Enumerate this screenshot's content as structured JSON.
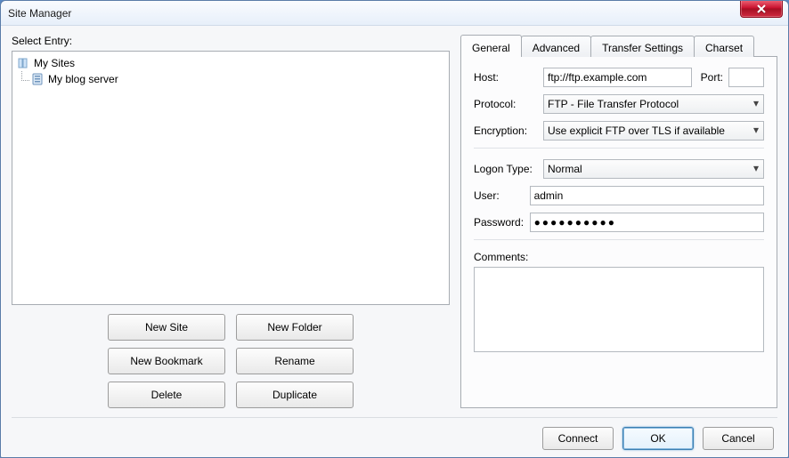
{
  "window": {
    "title": "Site Manager"
  },
  "left": {
    "select_label": "Select Entry:",
    "tree_root": "My Sites",
    "tree_child": "My blog server",
    "buttons": {
      "new_site": "New Site",
      "new_folder": "New Folder",
      "new_bookmark": "New Bookmark",
      "rename": "Rename",
      "delete": "Delete",
      "duplicate": "Duplicate"
    }
  },
  "tabs": {
    "general": "General",
    "advanced": "Advanced",
    "transfer": "Transfer Settings",
    "charset": "Charset"
  },
  "general": {
    "host_label": "Host:",
    "host_value": "ftp://ftp.example.com",
    "port_label": "Port:",
    "port_value": "",
    "protocol_label": "Protocol:",
    "protocol_value": "FTP - File Transfer Protocol",
    "encryption_label": "Encryption:",
    "encryption_value": "Use explicit FTP over TLS if available",
    "logon_label": "Logon Type:",
    "logon_value": "Normal",
    "user_label": "User:",
    "user_value": "admin",
    "password_label": "Password:",
    "password_value": "●●●●●●●●●●",
    "comments_label": "Comments:",
    "comments_value": ""
  },
  "footer": {
    "connect": "Connect",
    "ok": "OK",
    "cancel": "Cancel"
  }
}
